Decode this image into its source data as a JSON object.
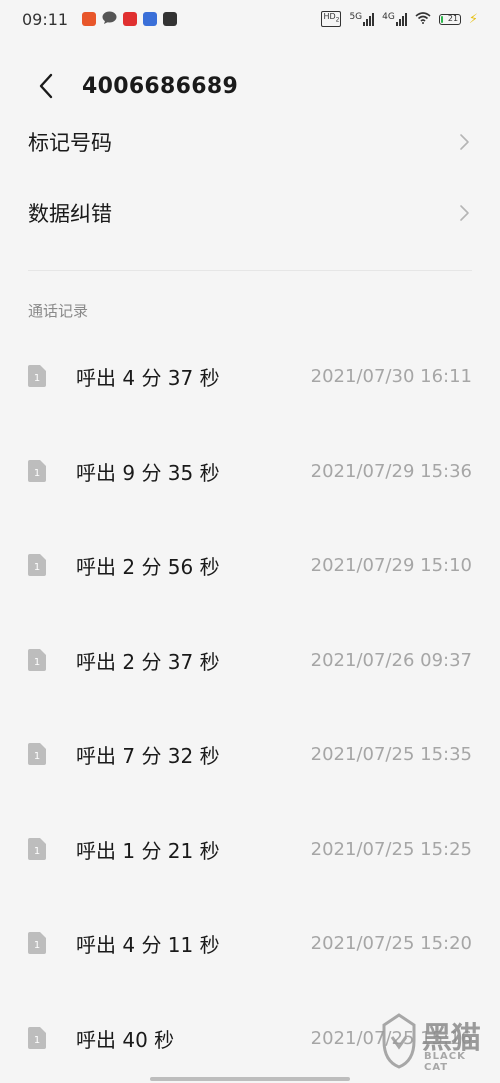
{
  "status_bar": {
    "time": "09:11",
    "hd_label": "HD",
    "hd_sub": "2",
    "net1_label": "5G",
    "net2_label": "4G",
    "battery_level": "21",
    "battery_percent": 21,
    "app_icons": [
      {
        "name": "news-app-icon",
        "color": "#e8562a"
      },
      {
        "name": "message-bubble-icon",
        "color": "#555555"
      },
      {
        "name": "red-app-icon",
        "color": "#e03030"
      },
      {
        "name": "mail-app-icon",
        "color": "#3a6fd8"
      },
      {
        "name": "photo-app-icon",
        "color": "#333333"
      }
    ]
  },
  "header": {
    "title": "4006686689"
  },
  "menu": {
    "items": [
      {
        "label": "标记号码"
      },
      {
        "label": "数据纠错"
      }
    ]
  },
  "call_log": {
    "section_label": "通话记录",
    "sim_label": "1",
    "entries": [
      {
        "desc": "呼出 4 分 37 秒",
        "time": "2021/07/30 16:11"
      },
      {
        "desc": "呼出 9 分 35 秒",
        "time": "2021/07/29 15:36"
      },
      {
        "desc": "呼出 2 分 56 秒",
        "time": "2021/07/29 15:10"
      },
      {
        "desc": "呼出 2 分 37 秒",
        "time": "2021/07/26 09:37"
      },
      {
        "desc": "呼出 7 分 32 秒",
        "time": "2021/07/25 15:35"
      },
      {
        "desc": "呼出 1 分 21 秒",
        "time": "2021/07/25 15:25"
      },
      {
        "desc": "呼出 4 分 11 秒",
        "time": "2021/07/25 15:20"
      },
      {
        "desc": "呼出 40 秒",
        "time": "2021/07/25 15:16"
      }
    ]
  },
  "watermark": {
    "text": "黑猫",
    "sub": "BLACK CAT"
  },
  "colors": {
    "background": "#f5f5f5",
    "primary_text": "#1a1a1a",
    "secondary_text": "#a6a6a6",
    "battery_green": "#2db84d"
  }
}
